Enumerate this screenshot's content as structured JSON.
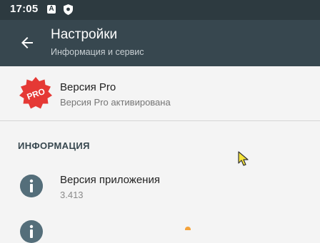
{
  "status_bar": {
    "time": "17:05",
    "icons": [
      "a-icon",
      "shield-icon"
    ]
  },
  "app_bar": {
    "title": "Настройки",
    "subtitle": "Информация и сервис",
    "back_icon": "arrow-back-icon",
    "color": "#37474f"
  },
  "pro": {
    "badge": "PRO",
    "title": "Версия Pro",
    "subtitle": "Версия Pro активирована",
    "badge_color": "#e53935"
  },
  "info_section": {
    "header": "ИНФОРМАЦИЯ",
    "items": [
      {
        "title": "Версия приложения",
        "value": "3.413",
        "icon": "info-icon"
      }
    ]
  }
}
